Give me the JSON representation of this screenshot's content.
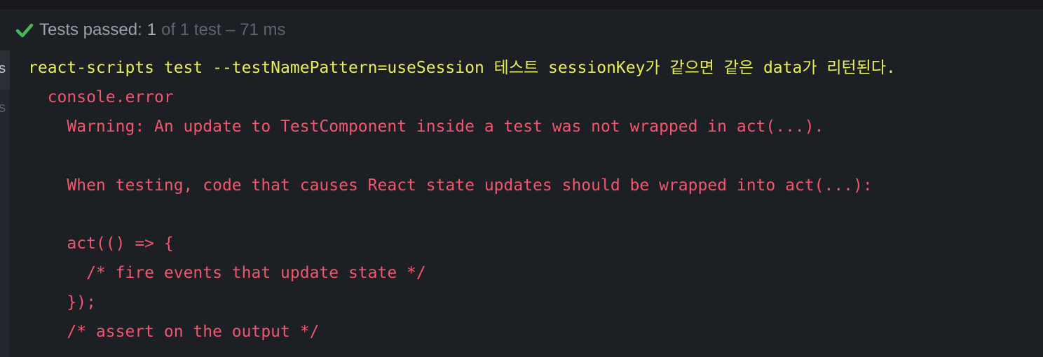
{
  "status": {
    "label": "Tests passed:",
    "passed": "1",
    "rest": "of 1 test – 71 ms",
    "icon": "check-icon",
    "accent_color": "#4bb35a"
  },
  "gutter": {
    "char_top": "s",
    "char_bottom": "s"
  },
  "console": {
    "command": "react-scripts test --testNamePattern=useSession 테스트 sessionKey가 같으면 같은 data가 리턴된다.",
    "lines": [
      "  console.error",
      "    Warning: An update to TestComponent inside a test was not wrapped in act(...).",
      "",
      "    When testing, code that causes React state updates should be wrapped into act(...):",
      "",
      "    act(() => {",
      "      /* fire events that update state */",
      "    });",
      "    /* assert on the output */"
    ],
    "colors": {
      "command": "#e7ef55",
      "error": "#f2566e"
    }
  }
}
